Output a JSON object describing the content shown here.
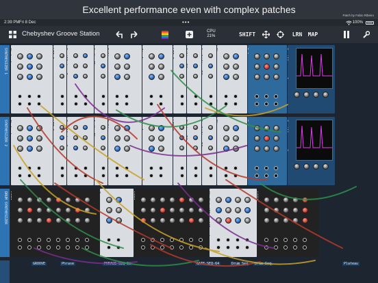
{
  "banner": {
    "headline": "Excellent performance even with complex patches",
    "credit": "Patch by Fabio Ribeiro"
  },
  "status_bar": {
    "time": "2:39 PM",
    "date": "Fri 8 Dec",
    "battery_percent": 100,
    "battery_text": "100%"
  },
  "toolbar": {
    "menu_icon": "grid-menu-icon",
    "patch_name": "Chebyshev Groove Station",
    "undo_icon": "undo-arrow-icon",
    "redo_icon": "redo-arrow-icon",
    "color_icon": "rainbow-color-icon",
    "add_icon": "plus-icon",
    "cpu_label": "CPU",
    "cpu_value": "21%",
    "shift_label": "SHIFT",
    "move_icon": "move-arrows-icon",
    "target_icon": "crosshair-icon",
    "learn_label": "LRN",
    "map_label": "MAP",
    "pause_icon": "pause-icon",
    "settings_icon": "wrench-icon"
  },
  "rack": {
    "rows": [
      {
        "row_label": "SYNTHESIZER 1",
        "modules": [
          {
            "name": "Chebyshev",
            "style": "light"
          },
          {
            "name": "LFO 1",
            "style": "light"
          },
          {
            "name": "Oscillator 2",
            "style": "light"
          },
          {
            "name": "Audio Mixer",
            "style": "light"
          },
          {
            "name": "Filter",
            "style": "light"
          },
          {
            "name": "Jiggler",
            "style": "light"
          },
          {
            "name": "LFO 2",
            "style": "light"
          },
          {
            "name": "Filter EG",
            "style": "light"
          },
          {
            "name": "Amplifier EG",
            "style": "light"
          },
          {
            "name": "Shaper",
            "style": "light"
          },
          {
            "name": "Delay",
            "style": "blue"
          },
          {
            "name": "Oscilloscope 1",
            "style": "scope"
          }
        ]
      },
      {
        "row_label": "SYNTHESIZER 2",
        "modules": [
          {
            "name": "Chebyshev",
            "style": "light"
          },
          {
            "name": "LFO 1",
            "style": "light"
          },
          {
            "name": "Oscillator 2",
            "style": "light"
          },
          {
            "name": "Audio Mixer",
            "style": "light"
          },
          {
            "name": "Filter",
            "style": "light"
          },
          {
            "name": "Jiggler",
            "style": "light"
          },
          {
            "name": "LFO 2",
            "style": "light"
          },
          {
            "name": "Filter EG",
            "style": "light"
          },
          {
            "name": "Amplifier EG",
            "style": "light"
          },
          {
            "name": "Shaper",
            "style": "light"
          },
          {
            "name": "Delay",
            "style": "blue"
          },
          {
            "name": "Oscilloscope 2",
            "style": "scope"
          }
        ]
      },
      {
        "row_label": "DRUM SYNTHESIZER",
        "modules": [
          {
            "name": "VCMA",
            "style": "dark"
          },
          {
            "name": "Snare",
            "style": "light"
          },
          {
            "name": "VCMA",
            "style": "dark"
          },
          {
            "name": "Hi Hat (Closed/Open)",
            "style": "light"
          },
          {
            "name": "VCMA",
            "style": "dark"
          }
        ]
      }
    ],
    "bottom_row_labels": [
      "GROOVE",
      "PHRASE-SEQ-32",
      "GATE-SEQ-64",
      "Phrase",
      "Drum Seq",
      "Drum Seq",
      "Plateau"
    ]
  }
}
